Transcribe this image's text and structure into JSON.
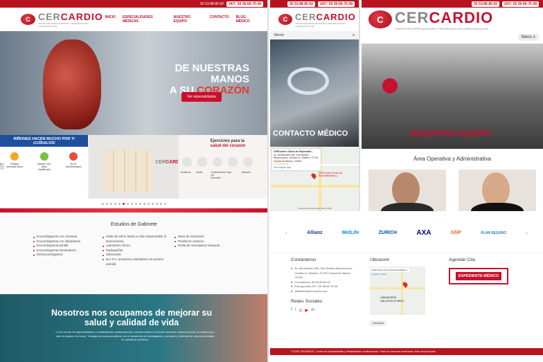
{
  "topbar": {
    "phone1": "55 53-88 80-92",
    "emergency": "24/7: 55 36-66-75-38"
  },
  "brand": {
    "mark": "C",
    "name_a": "CER",
    "name_b": "CARDIO",
    "tagline": "CENTRO DE ESPECIALIDADES Y REHABILITACIÓN CARDIOVASCULAR"
  },
  "nav": {
    "items": [
      "INICIO",
      "ESPECIALIDADES MÉDICAS",
      "NUESTRO EQUIPO",
      "CONTACTO",
      "BLOG MÉDICO"
    ]
  },
  "hero": {
    "line1": "DE NUESTRAS MANOS",
    "line2a": "A SU ",
    "line2b": "CORAZÓN",
    "button": "Ver especialidades"
  },
  "cards": {
    "c1_title": "RIÑONES HACEN MUCHO POR TI",
    "c1_sub": "¡CUÍDALOS!",
    "c1_tips": [
      "Realiza actividad física",
      "Mantén una dieta equilibrada",
      "No te automediques"
    ],
    "c3_title_a": "Ejercicios para la",
    "c3_title_b": "salud del corazón",
    "c3_items": [
      "Aeróbicos",
      "Cardio",
      "Entrenamiento por intervalos",
      "Yoga",
      "Natación"
    ]
  },
  "gabinete": {
    "title": "Estudios de Gabinete",
    "col1": [
      "Ecocardiograma con contraste",
      "Ecocardiograma con dobutamina",
      "Ecocardiograma portátil",
      "Ecocardiograma transtorácico",
      "Electrocardiograma"
    ],
    "col2": [
      "Holter de 24hrs hasta 14 días impermeable (3 derivaciones)",
      "Laboratorio clínico",
      "Radiografías",
      "Ultrasonido",
      "M.A.P.A. (monitoreo ambulatorio de presión arterial)"
    ],
    "col3": [
      "Mesa de inclinación",
      "Prueba de esfuerzo",
      "Renta de marcapasos temporal"
    ]
  },
  "mission": {
    "title": "Nosotros nos ocupamos de mejorar su salud y calidad de vida",
    "text": "Como centro de especialidades y rehabilitación cardiovascular, nuestra misión es brindar atención médica privada de calidad que esté al alcance de todos. Trabajamos comprometidos con el desarrollo de investigación, potentes y métodos de alta especialidad en medicina moderna."
  },
  "panel2": {
    "menu": "Menú",
    "contact_title": "CONTACTO MÉDICO",
    "map_name": "CERCardio Clínica de Especialid...",
    "map_addr": "Av. Montevideo 605, San Bartolo Atepehuacan, Gustavo A. Madero, 07730 Ciudad de México, CDMX",
    "map_rating": "4.5 ★★★★★",
    "map_link": "View larger map",
    "map_pin": "CERCardio Clínica de Especialidades y...",
    "map_footer": "Keyboard shortcuts  Map data ©2024"
  },
  "panel3": {
    "menu": "Menú",
    "team_title": "NUESTRO EQUIPO",
    "area": "Área Operativa y Administrativa"
  },
  "partners": [
    "Allianz",
    "MetLife",
    "ZURICH",
    "AXA",
    "GNP",
    "PLAN SEGURO"
  ],
  "footer": {
    "contact_h": "Contáctenos",
    "addr": "Av. Montevideo 605, San Bartolo Atepehuacan, Gustavo A. Madero, 07730 Ciudad de México, CDMX.",
    "consult": "Consultorios: 55 53-88 80-92",
    "emerg": "Emergencias 24/7: 55 36-66 75-38",
    "email": "asistentes@cercardio.com",
    "social_h": "Redes Sociales",
    "loc_h": "Ubicación",
    "loc_name": "CERCardio Clínica de Especialidades...",
    "loc_link": "Ampliar el mapa",
    "loc_area": "LINDAVISTA VALLEJO III SECC",
    "btn_more": "View More",
    "appt_h": "Agendar Cita",
    "appt_btn": "EXPEDIENTE MÉDICO",
    "copyright": "© 2025 CERCARDIO - Centro de Especialidades y Rehabilitación Cardiovascular. Todos los derechos reservados. Aviso de privacidad."
  },
  "colors": {
    "brand": "#c8102e",
    "topbar": "#b8141f",
    "teal": "#2b7885"
  }
}
